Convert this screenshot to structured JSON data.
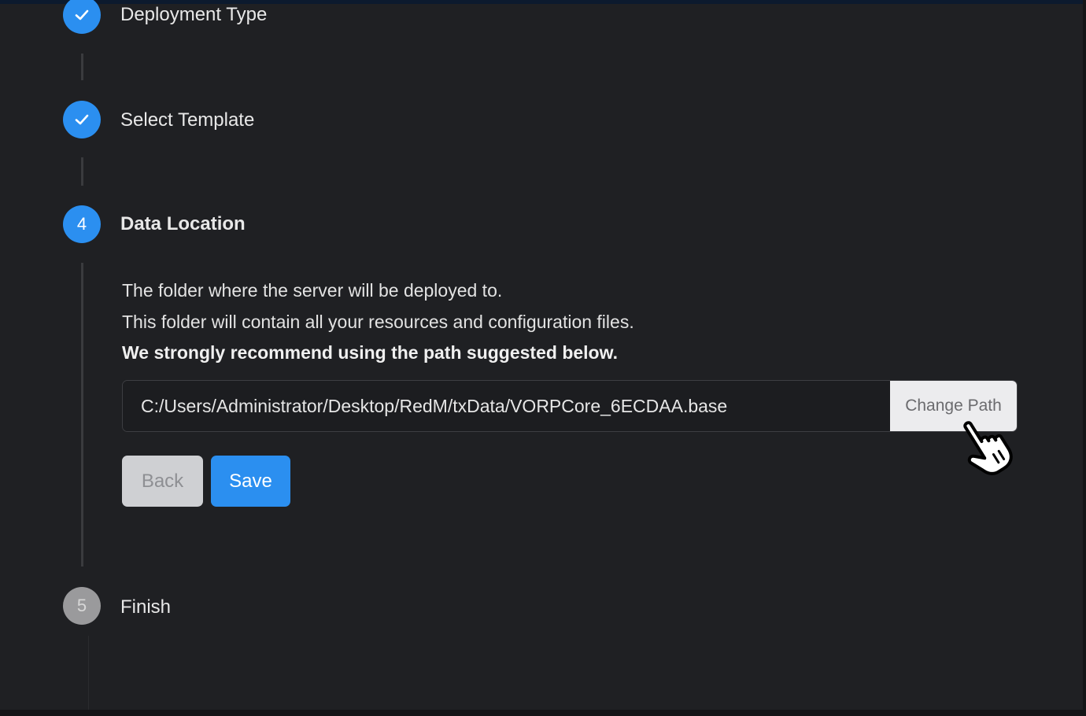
{
  "steps": [
    {
      "icon": "check-icon",
      "title": "Deployment Type",
      "state": "done"
    },
    {
      "icon": "check-icon",
      "title": "Select Template",
      "state": "done"
    },
    {
      "number": "4",
      "title": "Data Location",
      "state": "active"
    },
    {
      "number": "5",
      "title": "Finish",
      "state": "pending"
    }
  ],
  "data_location": {
    "line1": "The folder where the server will be deployed to.",
    "line2": "This folder will contain all your resources and configuration files.",
    "line3": "We strongly recommend using the path suggested below.",
    "path_value": "C:/Users/Administrator/Desktop/RedM/txData/VORPCore_6ECDAA.base",
    "change_path_label": "Change Path",
    "back_label": "Back",
    "save_label": "Save"
  },
  "colors": {
    "accent": "#2b8ff0",
    "background": "#1f2023",
    "pending": "#9a9a9c"
  },
  "cursor": {
    "icon": "hand-pointer-icon"
  }
}
